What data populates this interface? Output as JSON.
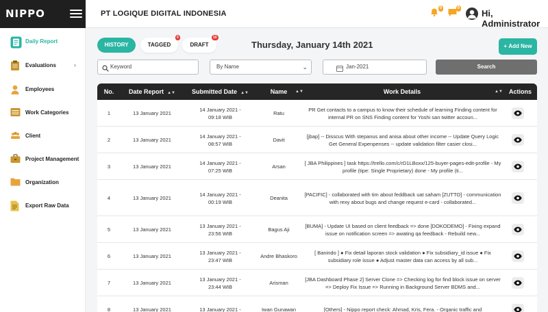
{
  "app": {
    "logo": "NIPPO",
    "company": "PT LOGIQUE DIGITAL INDONESIA"
  },
  "header": {
    "notif_count": "0",
    "msg_count": "0",
    "greeting": "Hi, Administrator"
  },
  "sidebar": {
    "items": [
      {
        "label": "Daily Report",
        "icon": "daily-report-icon",
        "active": true
      },
      {
        "label": "Evaluations",
        "icon": "evaluations-icon",
        "has_submenu": true
      },
      {
        "label": "Employees",
        "icon": "employees-icon"
      },
      {
        "label": "Work Categories",
        "icon": "work-categories-icon"
      },
      {
        "label": "Client",
        "icon": "client-icon"
      },
      {
        "label": "Project Management",
        "icon": "project-management-icon"
      },
      {
        "label": "Organization",
        "icon": "organization-icon"
      },
      {
        "label": "Export Raw Data",
        "icon": "export-icon"
      }
    ]
  },
  "tabs": {
    "history": "HISTORY",
    "tagged": "TAGGED",
    "tagged_count": "0",
    "draft": "DRAFT",
    "draft_count": "10"
  },
  "page_date": "Thursday, January 14th 2021",
  "add_new_label": "Add New",
  "filters": {
    "keyword_placeholder": "Keyword",
    "sort_value": "By Name",
    "month_value": "Jan-2021",
    "search_label": "Search"
  },
  "table": {
    "columns": [
      "No.",
      "Date Report",
      "Submitted Date",
      "Name",
      "Work Details",
      "Actions"
    ],
    "rows": [
      {
        "no": "1",
        "date": "13 January 2021",
        "submitted": "14 January 2021 - 09:18 WIB",
        "name": "Ratu",
        "details": "PR Get contacts to a campus to know their schedule of learning Finding content for internal PR on SNS Finding content for Yoshi san twitter accoun..."
      },
      {
        "no": "2",
        "date": "13 January 2021",
        "submitted": "14 January 2021 - 08:57 WIB",
        "name": "Davit",
        "details": "[jbap] -- Disscus With stepanus and anisa about other income -- Update Query Logic Get General Expenpenses -- update validation filter casier closi..."
      },
      {
        "no": "3",
        "date": "13 January 2021",
        "submitted": "14 January 2021 - 07:25 WIB",
        "name": "Arsan",
        "details": "[ JBA Philippines ] task https://trello.com/c/rD1LBoxx/125-buyer-pages-edit-profile - My profile (tipe: Single Proprietary) done - My profile (ti..."
      },
      {
        "no": "4",
        "date": "13 January 2021",
        "submitted": "14 January 2021 - 00:19 WIB",
        "name": "Deanita",
        "details": "[PACIFIC] - collaborated with tim about feddback uat saham [ZUTTO] - communication with rexy about bugs and change request e-card - collaborated..."
      },
      {
        "no": "5",
        "date": "13 January 2021",
        "submitted": "13 January 2021 - 23:56 WIB",
        "name": "Bagus Aji",
        "details": "[BUMA] - Update UI based on client feedback => done [DOKODEMO] - Fixing expand issue on notification screen => awating qa feedback - Rebuild new..."
      },
      {
        "no": "6",
        "date": "13 January 2021",
        "submitted": "13 January 2021 - 23:47 WIB",
        "name": "Andre Bhaskoro",
        "details": "[ Banindo ] ● Fix detail laporan stock validation ● Fix subsidiary_id issue ● Fix subsidiary role issue ● Adjust master data can access by all sub..."
      },
      {
        "no": "7",
        "date": "13 January 2021",
        "submitted": "13 January 2021 - 23:44 WIB",
        "name": "Arisman",
        "details": "[JBA Dashboard Phase 2] Server Clone => Checking log for find block issue on server => Deploy Fix Issue => Running in Background Server BDMS and..."
      },
      {
        "no": "8",
        "date": "13 January 2021",
        "submitted": "13 January 2021 -",
        "name": "Iwan Gunawan",
        "details": "[Others] - Nippo report check: Ahmad, Kris, Fera. - Organic traffic and"
      }
    ]
  },
  "colors": {
    "accent": "#2bb5a3",
    "dark": "#262626",
    "badge": "#e53935",
    "bell": "#f5a623"
  }
}
